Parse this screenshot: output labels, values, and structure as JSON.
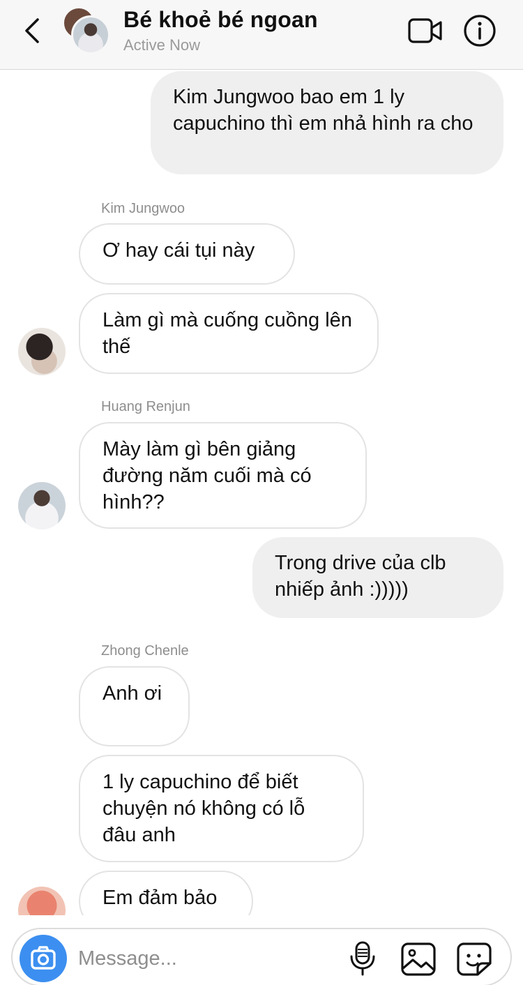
{
  "header": {
    "title": "Bé khoẻ bé ngoan",
    "status": "Active Now",
    "icons": {
      "back": "chevron-left-icon",
      "video": "video-camera-icon",
      "info": "info-icon"
    }
  },
  "messages": [
    {
      "sender": "",
      "direction": "out",
      "text": "Kim Jungwoo bao em 1 ly capuchino thì em nhả hình ra cho"
    },
    {
      "sender": "Kim Jungwoo",
      "direction": "in",
      "text": "Ơ hay cái tụi này"
    },
    {
      "sender": "Kim Jungwoo",
      "direction": "in",
      "text": "Làm gì mà cuống cuồng lên thế"
    },
    {
      "sender": "Huang Renjun",
      "direction": "in",
      "text": "Mày làm gì bên giảng đường năm cuối mà có hình??"
    },
    {
      "sender": "",
      "direction": "out",
      "text": "Trong drive của clb nhiếp ảnh :)))))"
    },
    {
      "sender": "Zhong Chenle",
      "direction": "in",
      "text": "Anh ơi"
    },
    {
      "sender": "Zhong Chenle",
      "direction": "in",
      "text": "1 ly capuchino để biết chuyện nó không có lỗ đâu anh"
    },
    {
      "sender": "Zhong Chenle",
      "direction": "in",
      "text": "Em đảm bảo"
    }
  ],
  "composer": {
    "placeholder": "Message...",
    "value": "",
    "icons": {
      "camera": "camera-icon",
      "mic": "microphone-icon",
      "gallery": "gallery-icon",
      "sticker": "sticker-icon"
    }
  },
  "colors": {
    "header_bg": "#f7f7f7",
    "outgoing_bubble": "#efefef",
    "incoming_border": "#e3e3e3",
    "camera_button": "#3c8ff0",
    "secondary_text": "#8e8e8e"
  }
}
